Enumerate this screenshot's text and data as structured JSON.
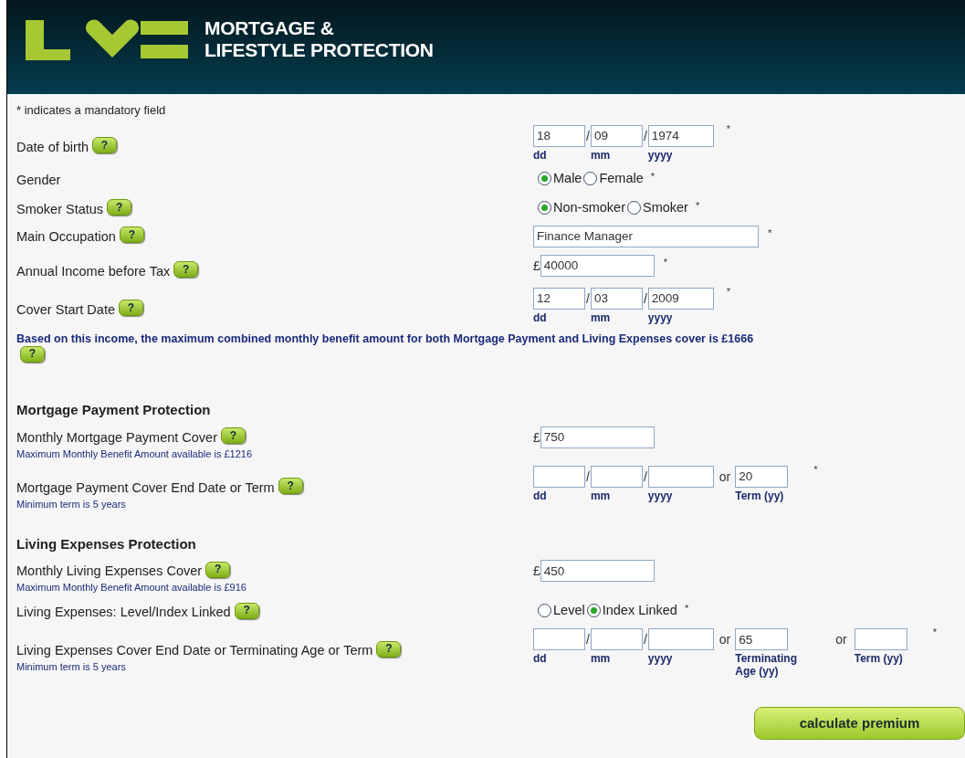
{
  "header": {
    "title_lines": [
      "MORTGAGE &",
      "LIFESTYLE PROTECTION"
    ]
  },
  "mandatory_note": "* indicates a mandatory field",
  "rows": [
    {
      "kind": "date",
      "label": "Date of birth",
      "help": "?",
      "mandatory": "*",
      "parts": [
        {
          "kind": "day",
          "value": "18",
          "hint": "dd"
        },
        {
          "kind": "sep",
          "text": "/"
        },
        {
          "kind": "month",
          "value": "09",
          "hint": "mm"
        },
        {
          "kind": "sep",
          "text": "/"
        },
        {
          "kind": "year",
          "value": "1974",
          "hint": "yyyy"
        }
      ]
    },
    {
      "kind": "radio",
      "label": "Gender",
      "mandatory": "*",
      "options": [
        {
          "label": "Male",
          "selected": true
        },
        {
          "label": "Female",
          "selected": false
        }
      ]
    },
    {
      "kind": "radio",
      "label": "Smoker Status",
      "help": "?",
      "mandatory": "*",
      "options": [
        {
          "label": "Non-smoker",
          "selected": true
        },
        {
          "label": "Smoker",
          "selected": false
        }
      ]
    },
    {
      "kind": "text",
      "label": "Main Occupation",
      "help": "?",
      "mandatory": "*",
      "value": "Finance Manager"
    },
    {
      "kind": "money",
      "label": "Annual Income before Tax",
      "help": "?",
      "mandatory": "*",
      "currency": "£",
      "value": "40000"
    },
    {
      "kind": "date",
      "label": "Cover Start Date",
      "help": "?",
      "mandatory": "*",
      "parts": [
        {
          "kind": "day",
          "value": "12",
          "hint": "dd"
        },
        {
          "kind": "sep",
          "text": "/"
        },
        {
          "kind": "month",
          "value": "03",
          "hint": "mm"
        },
        {
          "kind": "sep",
          "text": "/"
        },
        {
          "kind": "year",
          "value": "2009",
          "hint": "yyyy"
        }
      ]
    },
    {
      "kind": "info",
      "text": "Based on this income, the maximum combined monthly benefit amount for both Mortgage Payment and Living Expenses cover is **£1666**",
      "help": "?"
    },
    {
      "kind": "heading",
      "text": "Mortgage Payment Protection"
    },
    {
      "kind": "money",
      "label": "Monthly Mortgage Payment Cover",
      "help": "?",
      "note": "Maximum Monthly Benefit Amount available is £1216",
      "currency": "£",
      "value": "750"
    },
    {
      "kind": "date",
      "label": "Mortgage Payment Cover End Date or Term",
      "help": "?",
      "note": "Minimum term is 5 years",
      "mandatory": "*",
      "parts": [
        {
          "kind": "day",
          "hint": "dd"
        },
        {
          "kind": "sep",
          "text": "/"
        },
        {
          "kind": "month",
          "hint": "mm"
        },
        {
          "kind": "sep",
          "text": "/"
        },
        {
          "kind": "year",
          "hint": "yyyy"
        },
        {
          "kind": "sep",
          "text": "or"
        },
        {
          "kind": "term",
          "value": "20",
          "hint": "Term (yy)"
        }
      ]
    },
    {
      "kind": "heading",
      "text": "Living Expenses Protection"
    },
    {
      "kind": "money",
      "label": "Monthly Living Expenses Cover",
      "help": "?",
      "note": "Maximum Monthly Benefit Amount available is £916",
      "currency": "£",
      "value": "450"
    },
    {
      "kind": "radio",
      "label": "Living Expenses: Level/Index Linked",
      "help": "?",
      "mandatory": "*",
      "options": [
        {
          "label": "Level",
          "selected": false
        },
        {
          "label": "Index Linked",
          "selected": true
        }
      ]
    },
    {
      "kind": "date",
      "label": "Living Expenses Cover End Date or Terminating Age or Term",
      "help": "?",
      "note": "Minimum term is 5 years",
      "mandatory": "*",
      "parts": [
        {
          "kind": "day",
          "hint": "dd"
        },
        {
          "kind": "sep",
          "text": "/"
        },
        {
          "kind": "month",
          "hint": "mm"
        },
        {
          "kind": "sep",
          "text": "/"
        },
        {
          "kind": "year",
          "hint": "yyyy"
        },
        {
          "kind": "sep",
          "text": "or"
        },
        {
          "kind": "term",
          "value": "65",
          "hint": "Terminating Age (yy)"
        },
        {
          "kind": "sep",
          "text": "or"
        },
        {
          "kind": "term",
          "hint": "Term (yy)"
        }
      ]
    }
  ],
  "submit": "calculate premium"
}
